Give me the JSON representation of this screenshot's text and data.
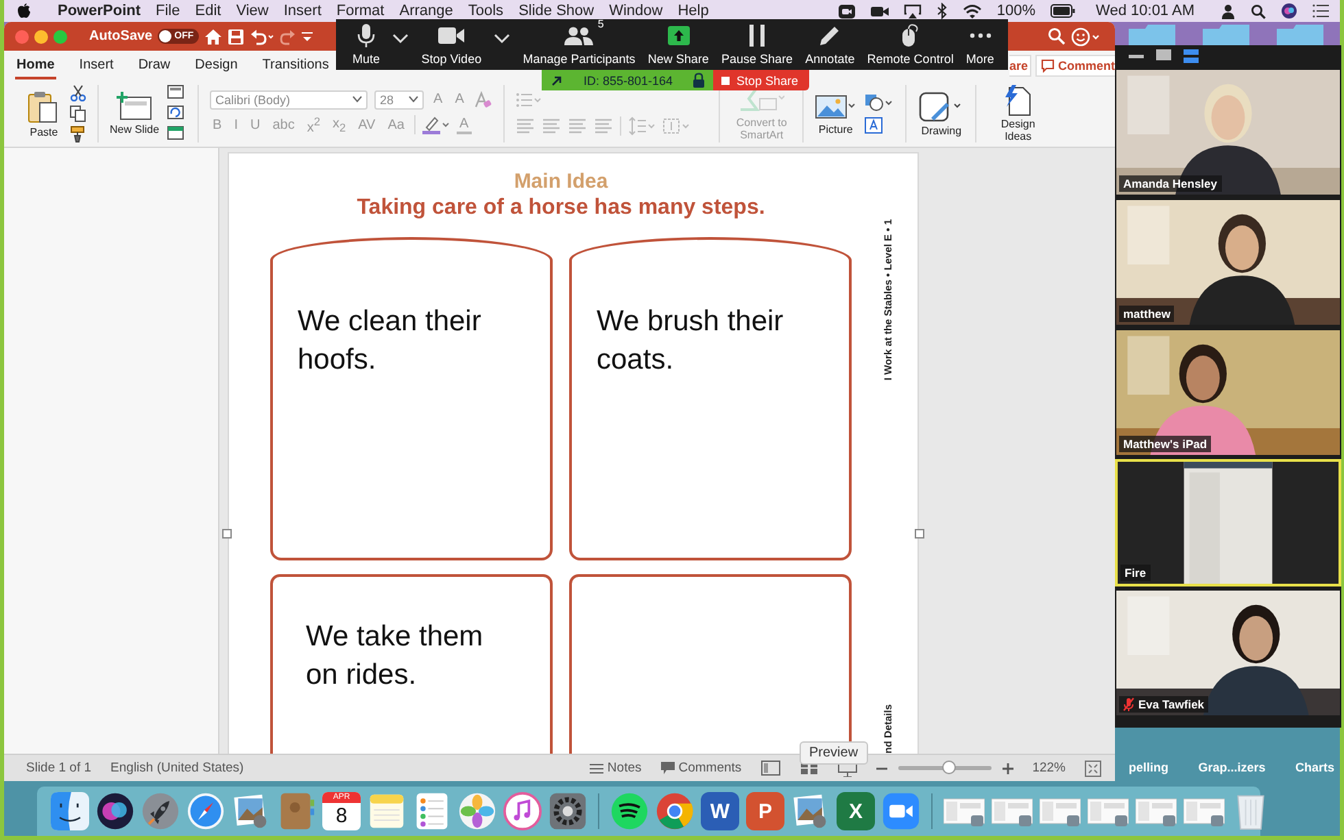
{
  "menu_bar": {
    "app": "PowerPoint",
    "menus": [
      "File",
      "Edit",
      "View",
      "Insert",
      "Format",
      "Arrange",
      "Tools",
      "Slide Show",
      "Window",
      "Help"
    ],
    "battery": "100%",
    "clock": "Wed 10:01 AM"
  },
  "title_bar": {
    "autosave": "AutoSave",
    "autosave_on": false,
    "toggle_text": "OFF"
  },
  "tabs": [
    {
      "label": "Home",
      "selected": true
    },
    {
      "label": "Insert",
      "selected": false
    },
    {
      "label": "Draw",
      "selected": false
    },
    {
      "label": "Design",
      "selected": false
    },
    {
      "label": "Transitions",
      "selected": false
    }
  ],
  "share_button": "are",
  "comments_button": "Comment",
  "ribbon": {
    "paste": "Paste",
    "new_slide": "New Slide",
    "font": "Calibri (Body)",
    "font_size": "28",
    "size_buttons": [
      "A",
      "A"
    ],
    "format_buttons": [
      "B",
      "I",
      "U",
      "abc",
      "x$^{2}$",
      "x$_{2}$",
      "AV",
      "Aa"
    ],
    "font_color": "A",
    "convert": "Convert to SmartArt",
    "picture": "Picture",
    "drawing": "Drawing",
    "design_ideas": "Design Ideas"
  },
  "zoom_toolbar": {
    "controls": [
      {
        "kind": "mic",
        "label": "Mute"
      },
      {
        "kind": "video",
        "label": "Stop Video"
      },
      {
        "kind": "participants",
        "label": "Manage Participants",
        "badge": "5"
      },
      {
        "kind": "share",
        "label": "New Share"
      },
      {
        "kind": "pause",
        "label": "Pause Share"
      },
      {
        "kind": "pencil",
        "label": "Annotate"
      },
      {
        "kind": "mouse",
        "label": "Remote Control"
      },
      {
        "kind": "more",
        "label": "More"
      }
    ],
    "meeting_id": "ID: 855-801-164",
    "stop_share": "Stop Share"
  },
  "slide": {
    "title": "Main Idea",
    "subtitle": "Taking care of a horse has many steps.",
    "boxes": [
      {
        "kind": "arch",
        "lines": [
          "We clean their",
          "hoofs."
        ]
      },
      {
        "kind": "arch",
        "lines": [
          "We brush their",
          "coats."
        ]
      },
      {
        "kind": "rect",
        "lines": [
          "We take them",
          "on rides."
        ]
      },
      {
        "kind": "rect"
      }
    ],
    "side_label": "I Work at the Stables • Level E • 1",
    "side_label_bottom": "nd Details"
  },
  "status_bar": {
    "slide_info": "Slide 1 of 1",
    "language": "English (United States)",
    "notes": "Notes",
    "comments": "Comments",
    "zoom": "122%",
    "level": 0.55
  },
  "tooltip": "Preview",
  "video_panel": {
    "participants": [
      {
        "name": "Amanda Hensley",
        "active": false,
        "muted": false
      },
      {
        "name": "matthew",
        "active": false,
        "muted": false
      },
      {
        "name": "Matthew's iPad",
        "active": false,
        "muted": false
      },
      {
        "name": "Fire",
        "active": true,
        "muted": false
      },
      {
        "name": "Eva Tawfiek",
        "active": false,
        "muted": true
      }
    ]
  },
  "desktop_folders": [
    "pelling",
    "Grap...izers",
    "Charts"
  ],
  "dock": [
    {
      "kind": "finder"
    },
    {
      "kind": "siri"
    },
    {
      "kind": "launchpad"
    },
    {
      "kind": "safari"
    },
    {
      "kind": "preview"
    },
    {
      "kind": "contacts"
    },
    {
      "kind": "calendar",
      "month": "APR",
      "day": "8"
    },
    {
      "kind": "notes"
    },
    {
      "kind": "reminders"
    },
    {
      "kind": "photos"
    },
    {
      "kind": "music"
    },
    {
      "kind": "settings"
    },
    {
      "kind": "separator"
    },
    {
      "kind": "spotify"
    },
    {
      "kind": "chrome"
    },
    {
      "kind": "letter",
      "letter": "W",
      "color": "#2b5eb5"
    },
    {
      "kind": "letter",
      "letter": "P",
      "color": "#d35230"
    },
    {
      "kind": "preview"
    },
    {
      "kind": "letter",
      "letter": "X",
      "color": "#1f7a44"
    },
    {
      "kind": "zoom"
    },
    {
      "kind": "separator"
    },
    {
      "kind": "window"
    },
    {
      "kind": "window"
    },
    {
      "kind": "window"
    },
    {
      "kind": "window"
    },
    {
      "kind": "window"
    },
    {
      "kind": "window"
    },
    {
      "kind": "trash"
    }
  ]
}
